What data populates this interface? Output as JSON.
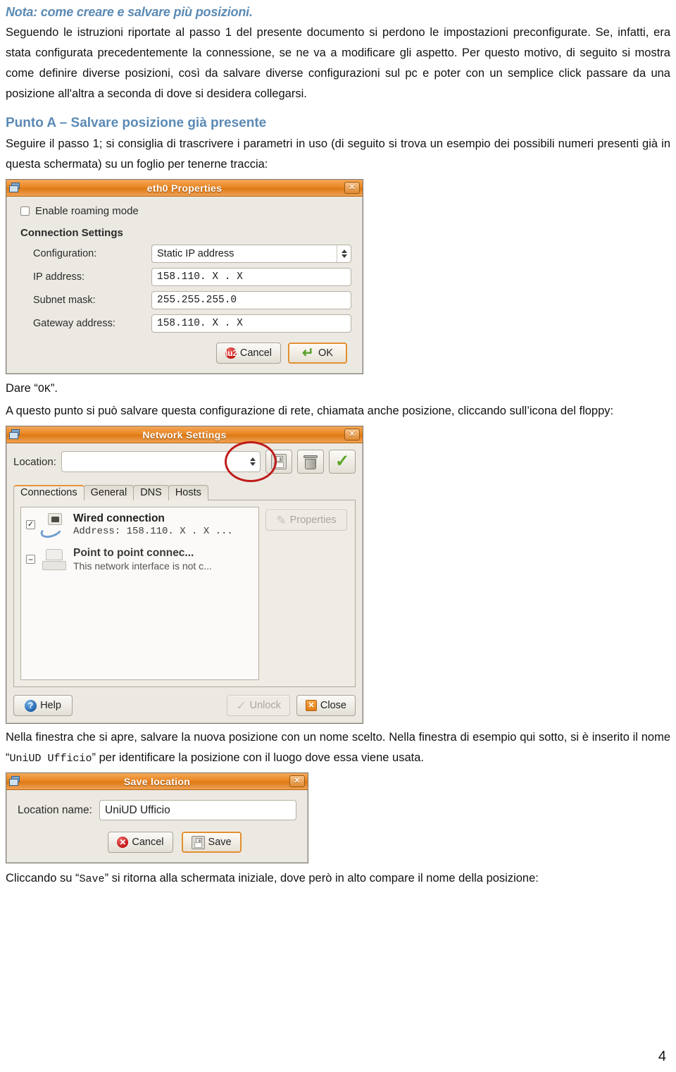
{
  "document": {
    "heading_note": "Nota: come creare e salvare più posizioni.",
    "intro_paragraph": "Seguendo le istruzioni riportate al passo 1 del presente documento si perdono le impostazioni preconfigurate. Se, infatti, era stata configurata precedentemente la connessione, se ne va a modificare gli aspetto. Per questo motivo, di seguito si mostra come definire diverse posizioni, così da salvare diverse configurazioni sul pc e poter con un semplice click passare da una posizione all'altra a seconda di dove si desidera collegarsi.",
    "heading_punto_a": "Punto A – Salvare posizione già presente",
    "paragraph_punto_a": "Seguire il passo 1; si consiglia di trascrivere i parametri in uso (di seguito si trova un esempio dei possibili numeri presenti già in questa schermata) su un foglio per tenerne traccia:",
    "caption_dare_ok_pre": "Dare “",
    "caption_dare_ok_code": "OK",
    "caption_dare_ok_post": "”.",
    "paragraph_floppy": "A questo punto si può salvare questa configurazione di rete, chiamata anche posizione, cliccando sull’icona del floppy:",
    "paragraph_save_pre": "Nella finestra che si apre, salvare la nuova posizione con un nome scelto. Nella finestra di esempio qui sotto, si è inserito il nome “",
    "paragraph_save_code": "UniUD Ufficio",
    "paragraph_save_post": "” per identificare la posizione con il luogo dove essa viene usata.",
    "paragraph_final_pre": "Cliccando su “",
    "paragraph_final_code": "Save",
    "paragraph_final_post": "” si ritorna alla schermata iniziale, dove però in alto compare il nome della posizione:",
    "page_number": "4",
    "colors": {
      "heading_blue": "#5B8AB5",
      "titlebar_orange": "#e98724",
      "highlight_red": "#c01b1b",
      "dialog_grey": "#ece9e2"
    }
  },
  "eth0_dialog": {
    "title": "eth0 Properties",
    "close_label": "✕",
    "roaming_checkbox_label": "Enable roaming mode",
    "roaming_checked": false,
    "section_title": "Connection Settings",
    "fields": [
      {
        "label": "Configuration:",
        "value": "Static IP address",
        "type": "combo"
      },
      {
        "label": "IP address:",
        "value": "158.110. X  . X",
        "type": "text"
      },
      {
        "label": "Subnet mask:",
        "value": "255.255.255.0",
        "type": "text"
      },
      {
        "label": "Gateway address:",
        "value": "158.110. X  . X",
        "type": "text"
      }
    ],
    "cancel_label": "Cancel",
    "ok_label": "OK"
  },
  "network_settings_dialog": {
    "title": "Network Settings",
    "close_label": "✕",
    "location_label": "Location:",
    "location_value": "",
    "location_placeholder": "",
    "toolbar": {
      "save_icon": "floppy-icon",
      "delete_icon": "trash-icon",
      "confirm_icon": "green-check-icon"
    },
    "tabs": [
      {
        "label": "Connections",
        "active": true
      },
      {
        "label": "General",
        "active": false
      },
      {
        "label": "DNS",
        "active": false
      },
      {
        "label": "Hosts",
        "active": false
      }
    ],
    "connections": [
      {
        "checked": true,
        "icon": "wired-network-icon",
        "name": "Wired connection",
        "detail": "Address: 158.110. X  . X  ..."
      },
      {
        "checked": false,
        "icon": "phone-modem-icon",
        "name": "Point to point connec...",
        "detail": "This network interface is not c..."
      }
    ],
    "properties_label": "Properties",
    "properties_enabled": false,
    "help_label": "Help",
    "unlock_label": "Unlock",
    "unlock_enabled": false,
    "close_button_label": "Close"
  },
  "save_location_dialog": {
    "title": "Save location",
    "close_label": "✕",
    "name_label": "Location name:",
    "name_value": "UniUD Ufficio",
    "cancel_label": "Cancel",
    "save_label": "Save"
  }
}
